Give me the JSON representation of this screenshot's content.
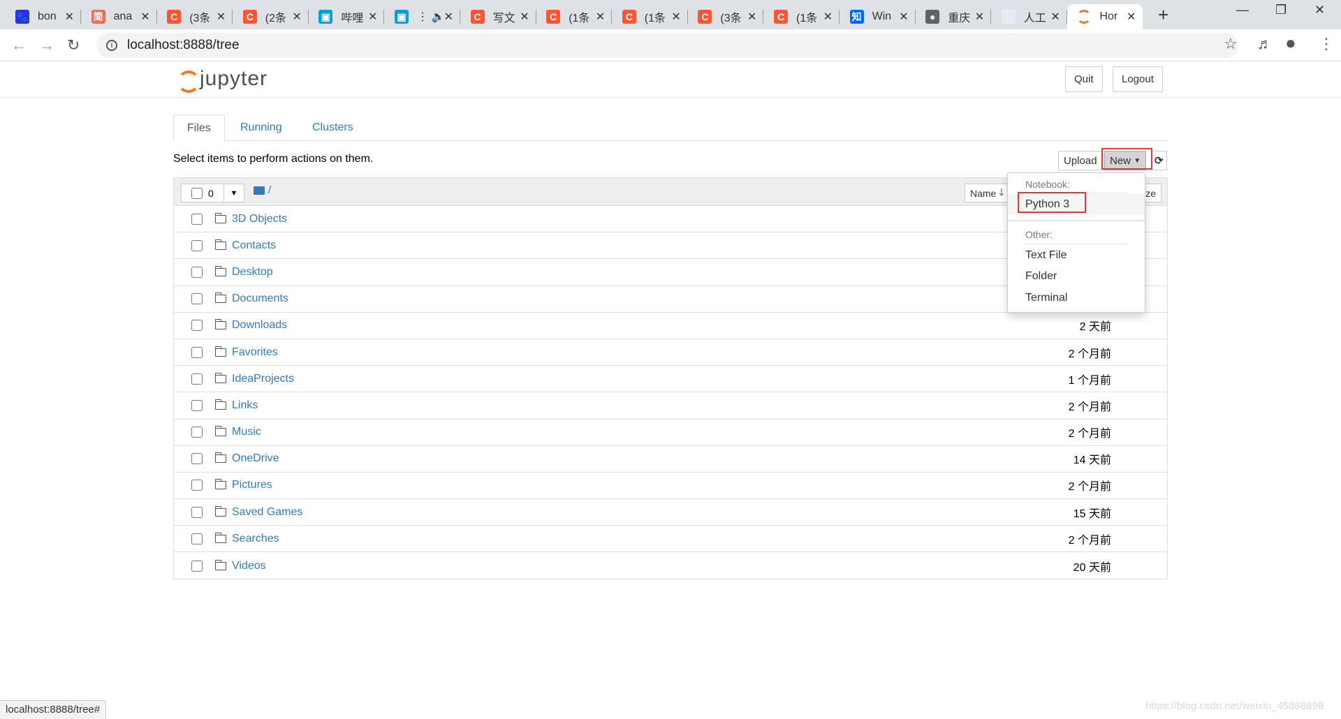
{
  "browser": {
    "tabs": [
      {
        "title": "bon",
        "icon": "baidu-icon",
        "color": "#2932e1",
        "glyph": "🐾"
      },
      {
        "title": "ana",
        "icon": "jianshu-icon",
        "color": "#ea6f5a",
        "glyph": "简"
      },
      {
        "title": "(3条",
        "icon": "csdn-icon",
        "color": "#fc5531",
        "glyph": "C"
      },
      {
        "title": "(2条",
        "icon": "csdn-icon",
        "color": "#fc5531",
        "glyph": "C"
      },
      {
        "title": "哔哩",
        "icon": "bilibili-icon",
        "color": "#00a1d6",
        "glyph": "▣"
      },
      {
        "title": "⋮ 🔈",
        "icon": "bilibili-icon",
        "color": "#00a1d6",
        "glyph": "▣"
      },
      {
        "title": "写文",
        "icon": "csdn-icon",
        "color": "#fc5531",
        "glyph": "C"
      },
      {
        "title": "(1条",
        "icon": "csdn-icon",
        "color": "#fc5531",
        "glyph": "C"
      },
      {
        "title": "(1条",
        "icon": "csdn-icon",
        "color": "#fc5531",
        "glyph": "C"
      },
      {
        "title": "(3条",
        "icon": "csdn-icon",
        "color": "#fc5531",
        "glyph": "C"
      },
      {
        "title": "(1条",
        "icon": "csdn-icon",
        "color": "#fc5531",
        "glyph": "C"
      },
      {
        "title": "Win",
        "icon": "zhihu-icon",
        "color": "#0066ff",
        "glyph": "知"
      },
      {
        "title": "重庆",
        "icon": "globe-icon",
        "color": "#5f6368",
        "glyph": "●"
      },
      {
        "title": "人工",
        "icon": "blank-page-icon",
        "color": "#e8eaf6",
        "glyph": ""
      },
      {
        "title": "Hor",
        "icon": "jupyter-icon",
        "color": "#ffffff",
        "glyph": ""
      }
    ],
    "url": "localhost:8888/tree",
    "status_url": "localhost:8888/tree#",
    "watermark": "https://blog.csdn.net/weixin_45888898"
  },
  "header": {
    "logo": "jupyter",
    "quit": "Quit",
    "logout": "Logout"
  },
  "nav_tabs": [
    "Files",
    "Running",
    "Clusters"
  ],
  "toolbar": {
    "hint": "Select items to perform actions on them.",
    "upload": "Upload",
    "new": "New",
    "refresh_icon": "refresh-icon"
  },
  "list": {
    "selected_count": "0",
    "breadcrumb": "/",
    "sort_name": "Name",
    "sort_size": "File size",
    "items": [
      {
        "name": "3D Objects",
        "date": ""
      },
      {
        "name": "Contacts",
        "date": ""
      },
      {
        "name": "Desktop",
        "date": ""
      },
      {
        "name": "Documents",
        "date": ""
      },
      {
        "name": "Downloads",
        "date": "2 天前"
      },
      {
        "name": "Favorites",
        "date": "2 个月前"
      },
      {
        "name": "IdeaProjects",
        "date": "1 个月前"
      },
      {
        "name": "Links",
        "date": "2 个月前"
      },
      {
        "name": "Music",
        "date": "2 个月前"
      },
      {
        "name": "OneDrive",
        "date": "14 天前"
      },
      {
        "name": "Pictures",
        "date": "2 个月前"
      },
      {
        "name": "Saved Games",
        "date": "15 天前"
      },
      {
        "name": "Searches",
        "date": "2 个月前"
      },
      {
        "name": "Videos",
        "date": "20 天前"
      }
    ]
  },
  "new_menu": {
    "notebook_header": "Notebook:",
    "python3": "Python 3",
    "other_header": "Other:",
    "text_file": "Text File",
    "folder": "Folder",
    "terminal": "Terminal"
  },
  "colors": {
    "link": "#337ab7",
    "highlight": "#e8353a",
    "jupyter_orange": "#f37726"
  }
}
